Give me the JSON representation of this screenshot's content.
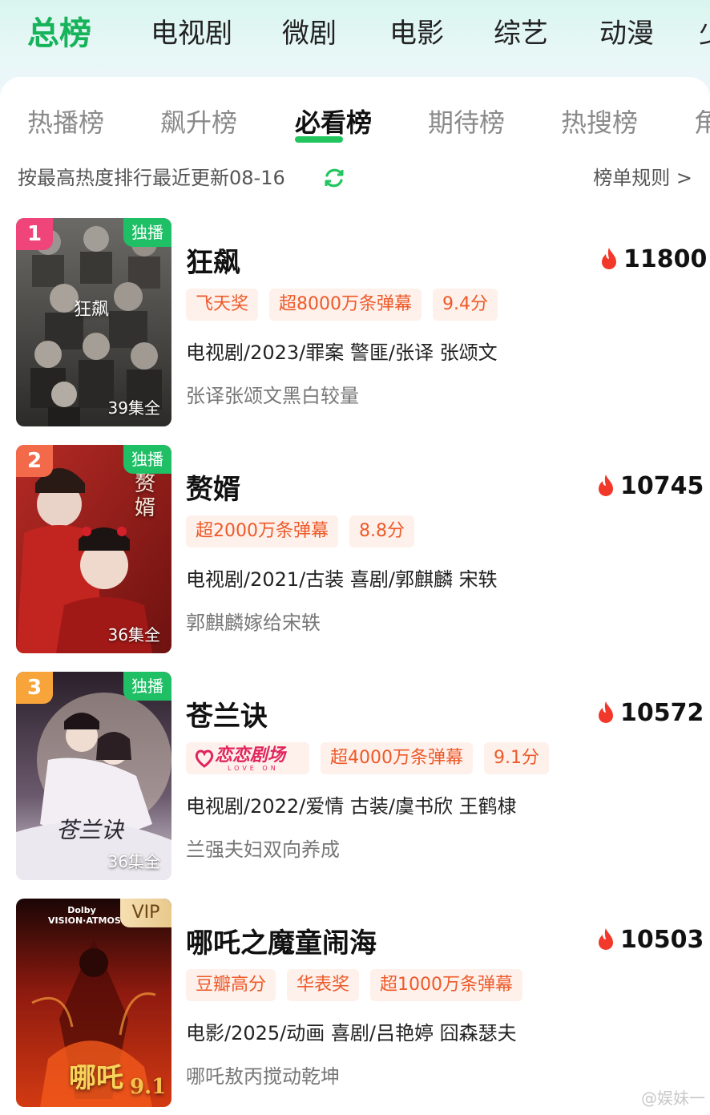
{
  "category_tabs": [
    {
      "label": "总榜",
      "active": true
    },
    {
      "label": "电视剧"
    },
    {
      "label": "微剧"
    },
    {
      "label": "电影"
    },
    {
      "label": "综艺"
    },
    {
      "label": "动漫"
    },
    {
      "label": "少"
    }
  ],
  "sub_tabs": [
    {
      "label": "热播榜"
    },
    {
      "label": "飙升榜"
    },
    {
      "label": "必看榜",
      "active": true
    },
    {
      "label": "期待榜"
    },
    {
      "label": "热搜榜"
    },
    {
      "label": "角"
    }
  ],
  "info": {
    "text": "按最高热度排行最近更新08-16",
    "rules_label": "榜单规则 >"
  },
  "colors": {
    "accent_green": "#17b35a",
    "tag_text": "#ee5a2a",
    "tag_bg": "#fef0ea",
    "rank1": "#f0457a",
    "rank2": "#f36a4a",
    "rank3": "#f7a53a"
  },
  "items": [
    {
      "rank": "1",
      "badge": "独播",
      "episodes": "39集全",
      "poster_text": "狂飙",
      "title": "狂飙",
      "heat": "11800",
      "tags": [
        "飞天奖",
        "超8000万条弹幕",
        "9.4分"
      ],
      "meta": "电视剧/2023/罪案 警匪/张译 张颂文",
      "desc": "张译张颂文黑白较量"
    },
    {
      "rank": "2",
      "badge": "独播",
      "episodes": "36集全",
      "poster_text": "赘婿",
      "title": "赘婿",
      "heat": "10745",
      "tags": [
        "超2000万条弹幕",
        "8.8分"
      ],
      "meta": "电视剧/2021/古装 喜剧/郭麒麟 宋轶",
      "desc": "郭麒麟嫁给宋轶"
    },
    {
      "rank": "3",
      "badge": "独播",
      "episodes": "36集全",
      "poster_text": "苍兰诀",
      "title": "苍兰诀",
      "heat": "10572",
      "logo_tag": {
        "text": "恋恋剧场",
        "sub": "LOVE ON"
      },
      "tags": [
        "超4000万条弹幕",
        "9.1分"
      ],
      "meta": "电视剧/2022/爱情 古装/虞书欣 王鹤棣",
      "desc": "兰强夫妇双向养成"
    },
    {
      "rank": "",
      "badge": "VIP",
      "dolby": "Dolby VISION·ATMOS",
      "poster_text": "哪吒",
      "poster_score": "9.1",
      "title": "哪吒之魔童闹海",
      "heat": "10503",
      "tags": [
        "豆瓣高分",
        "华表奖",
        "超1000万条弹幕"
      ],
      "meta": "电影/2025/动画 喜剧/吕艳婷 囧森瑟夫",
      "desc": "哪吒敖丙搅动乾坤"
    }
  ],
  "watermark": "@娱妹一"
}
